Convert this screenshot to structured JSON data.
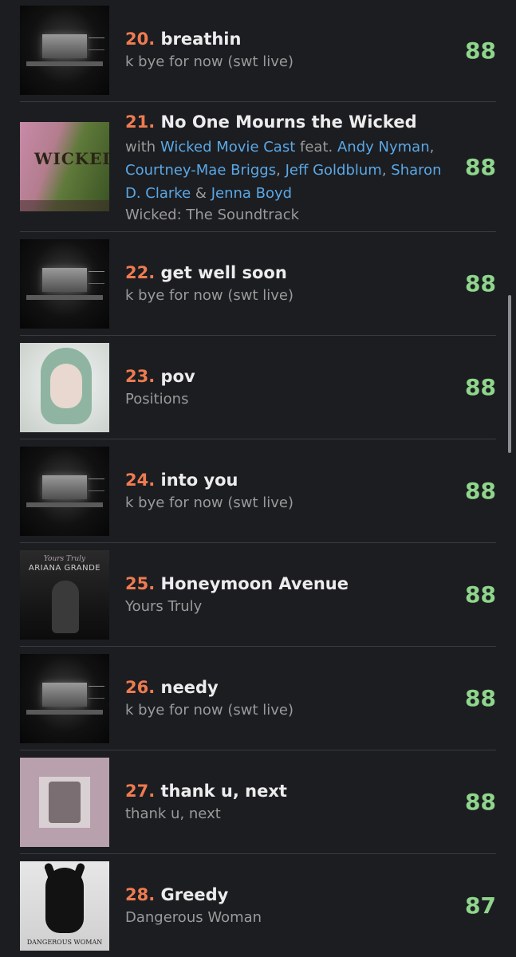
{
  "rows": [
    {
      "rank": "20.",
      "title": "breathin",
      "album": "k bye for now (swt live)",
      "score": "88",
      "cover": "live"
    },
    {
      "rank": "21.",
      "title": "No One Mourns the Wicked",
      "credits": {
        "with_label": "with",
        "with_artist": "Wicked Movie Cast",
        "feat_label": "feat.",
        "feat_artist_1": "Andy Nyman",
        "feat_artist_2": "Courtney-Mae Briggs",
        "feat_artist_3": "Jeff Goldblum",
        "feat_artist_4": "Sharon D. Clarke",
        "amp": "&",
        "feat_artist_5": "Jenna Boyd"
      },
      "album": "Wicked: The Soundtrack",
      "score": "88",
      "cover": "wicked",
      "cover_text": "WICKED"
    },
    {
      "rank": "22.",
      "title": "get well soon",
      "album": "k bye for now (swt live)",
      "score": "88",
      "cover": "live"
    },
    {
      "rank": "23.",
      "title": "pov",
      "album": "Positions",
      "score": "88",
      "cover": "positions"
    },
    {
      "rank": "24.",
      "title": "into you",
      "album": "k bye for now (swt live)",
      "score": "88",
      "cover": "live"
    },
    {
      "rank": "25.",
      "title": "Honeymoon Avenue",
      "album": "Yours Truly",
      "score": "88",
      "cover": "yours-truly",
      "cover_text_1": "Yours Truly",
      "cover_text_2": "ARIANA GRANDE"
    },
    {
      "rank": "26.",
      "title": "needy",
      "album": "k bye for now (swt live)",
      "score": "88",
      "cover": "live"
    },
    {
      "rank": "27.",
      "title": "thank u, next",
      "album": "thank u, next",
      "score": "88",
      "cover": "thank-u-next"
    },
    {
      "rank": "28.",
      "title": "Greedy",
      "album": "Dangerous Woman",
      "score": "87",
      "cover": "dangerous-woman",
      "cover_text": "DANGEROUS WOMAN"
    }
  ],
  "colors": {
    "background": "#1c1d21",
    "rank": "#ef7b50",
    "score": "#8fd68c",
    "link": "#5aa8e6",
    "subtext": "#9a9a9a",
    "title": "#ececec"
  }
}
